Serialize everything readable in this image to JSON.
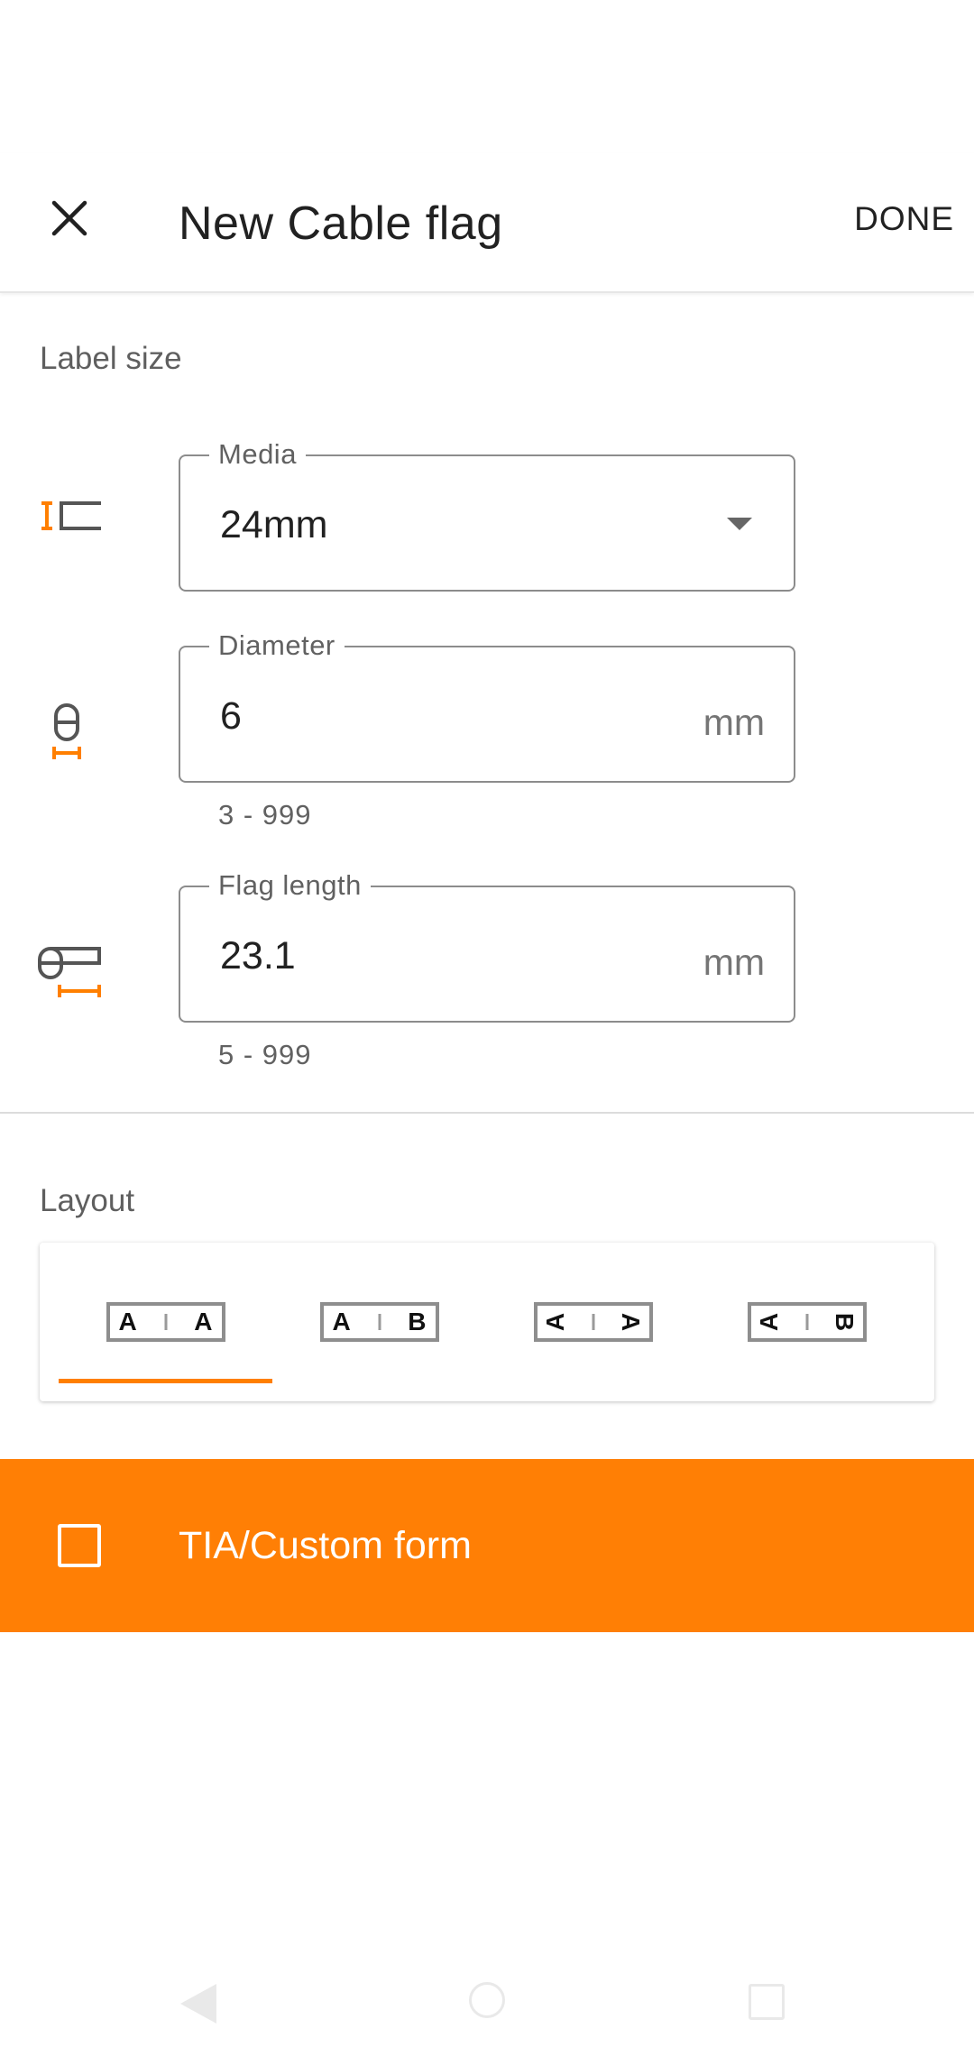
{
  "toolbar": {
    "title": "New Cable flag",
    "done_label": "DONE"
  },
  "label_size": {
    "heading": "Label size",
    "media": {
      "label": "Media",
      "value": "24mm"
    },
    "diameter": {
      "label": "Diameter",
      "value": "6",
      "unit": "mm",
      "helper": "3 - 999"
    },
    "flag_length": {
      "label": "Flag length",
      "value": "23.1",
      "unit": "mm",
      "helper": "5 - 999"
    }
  },
  "layout": {
    "heading": "Layout",
    "options": [
      {
        "left": "A",
        "right": "A",
        "selected": true
      },
      {
        "left": "A",
        "right": "B",
        "selected": false
      },
      {
        "left": "A",
        "right": "A",
        "selected": false
      },
      {
        "left": "A",
        "right": "B",
        "selected": false
      }
    ]
  },
  "tia": {
    "label": "TIA/Custom form",
    "checked": false,
    "color": "#ff7f05"
  },
  "colors": {
    "accent": "#ff7f00",
    "icon_dark": "#555555"
  }
}
